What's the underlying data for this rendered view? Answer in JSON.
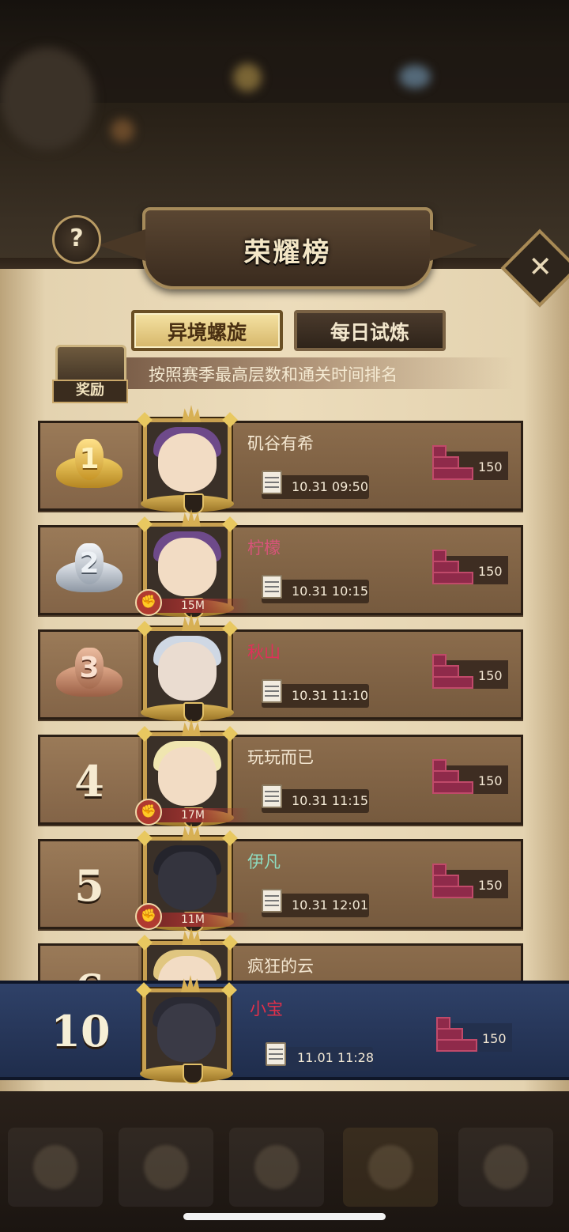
{
  "header": {
    "title": "荣耀榜",
    "help_icon": "?",
    "close_icon": "✕"
  },
  "tabs": [
    {
      "label": "异境螺旋",
      "active": true
    },
    {
      "label": "每日试炼",
      "active": false
    }
  ],
  "reward": {
    "label": "奖励",
    "hint": "按照赛季最高层数和通关时间排名"
  },
  "rows": [
    {
      "rank": "1",
      "medal": "gold",
      "name": "矶谷有希",
      "name_color": "#f3e6d0",
      "power": "",
      "time": "10.31 09:50",
      "floor": "150"
    },
    {
      "rank": "2",
      "medal": "silver",
      "name": "柠檬",
      "name_color": "#d8547a",
      "power": "15M",
      "time": "10.31 10:15",
      "floor": "150"
    },
    {
      "rank": "3",
      "medal": "bronze",
      "name": "秋山",
      "name_color": "#e0305a",
      "power": "",
      "time": "10.31 11:10",
      "floor": "150"
    },
    {
      "rank": "4",
      "medal": "",
      "name": "玩玩而已",
      "name_color": "#f3e6d0",
      "power": "17M",
      "time": "10.31 11:15",
      "floor": "150"
    },
    {
      "rank": "5",
      "medal": "",
      "name": "伊凡",
      "name_color": "#8fdcc0",
      "power": "11M",
      "time": "10.31 12:01",
      "floor": "150"
    },
    {
      "rank": "6",
      "medal": "",
      "name": "疯狂的云",
      "name_color": "#f3e6d0",
      "power": "",
      "time": "",
      "floor": ""
    }
  ],
  "my_rank": {
    "rank": "10",
    "name": "小宝",
    "name_color": "#e0304a",
    "time": "11.01 11:28",
    "floor": "150"
  },
  "colors": {
    "panel": "#ecdcbb",
    "row": "#8b6c4c",
    "my_row": "#2f4168",
    "floor_icon": "#8f2a4a"
  },
  "icons": [
    "help-icon",
    "close-icon",
    "chest-icon",
    "calendar-icon",
    "stairs-icon",
    "fist-icon",
    "crown-icon"
  ]
}
